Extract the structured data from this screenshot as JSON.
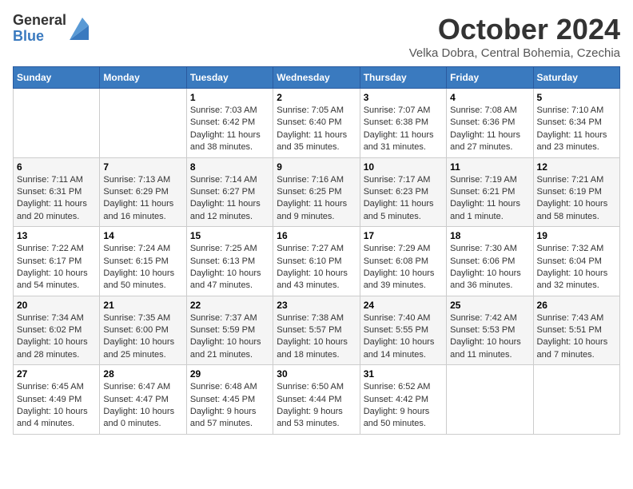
{
  "logo": {
    "general": "General",
    "blue": "Blue"
  },
  "title": "October 2024",
  "subtitle": "Velka Dobra, Central Bohemia, Czechia",
  "days_header": [
    "Sunday",
    "Monday",
    "Tuesday",
    "Wednesday",
    "Thursday",
    "Friday",
    "Saturday"
  ],
  "weeks": [
    [
      {
        "day": "",
        "sunrise": "",
        "sunset": "",
        "daylight": ""
      },
      {
        "day": "",
        "sunrise": "",
        "sunset": "",
        "daylight": ""
      },
      {
        "day": "1",
        "sunrise": "Sunrise: 7:03 AM",
        "sunset": "Sunset: 6:42 PM",
        "daylight": "Daylight: 11 hours and 38 minutes."
      },
      {
        "day": "2",
        "sunrise": "Sunrise: 7:05 AM",
        "sunset": "Sunset: 6:40 PM",
        "daylight": "Daylight: 11 hours and 35 minutes."
      },
      {
        "day": "3",
        "sunrise": "Sunrise: 7:07 AM",
        "sunset": "Sunset: 6:38 PM",
        "daylight": "Daylight: 11 hours and 31 minutes."
      },
      {
        "day": "4",
        "sunrise": "Sunrise: 7:08 AM",
        "sunset": "Sunset: 6:36 PM",
        "daylight": "Daylight: 11 hours and 27 minutes."
      },
      {
        "day": "5",
        "sunrise": "Sunrise: 7:10 AM",
        "sunset": "Sunset: 6:34 PM",
        "daylight": "Daylight: 11 hours and 23 minutes."
      }
    ],
    [
      {
        "day": "6",
        "sunrise": "Sunrise: 7:11 AM",
        "sunset": "Sunset: 6:31 PM",
        "daylight": "Daylight: 11 hours and 20 minutes."
      },
      {
        "day": "7",
        "sunrise": "Sunrise: 7:13 AM",
        "sunset": "Sunset: 6:29 PM",
        "daylight": "Daylight: 11 hours and 16 minutes."
      },
      {
        "day": "8",
        "sunrise": "Sunrise: 7:14 AM",
        "sunset": "Sunset: 6:27 PM",
        "daylight": "Daylight: 11 hours and 12 minutes."
      },
      {
        "day": "9",
        "sunrise": "Sunrise: 7:16 AM",
        "sunset": "Sunset: 6:25 PM",
        "daylight": "Daylight: 11 hours and 9 minutes."
      },
      {
        "day": "10",
        "sunrise": "Sunrise: 7:17 AM",
        "sunset": "Sunset: 6:23 PM",
        "daylight": "Daylight: 11 hours and 5 minutes."
      },
      {
        "day": "11",
        "sunrise": "Sunrise: 7:19 AM",
        "sunset": "Sunset: 6:21 PM",
        "daylight": "Daylight: 11 hours and 1 minute."
      },
      {
        "day": "12",
        "sunrise": "Sunrise: 7:21 AM",
        "sunset": "Sunset: 6:19 PM",
        "daylight": "Daylight: 10 hours and 58 minutes."
      }
    ],
    [
      {
        "day": "13",
        "sunrise": "Sunrise: 7:22 AM",
        "sunset": "Sunset: 6:17 PM",
        "daylight": "Daylight: 10 hours and 54 minutes."
      },
      {
        "day": "14",
        "sunrise": "Sunrise: 7:24 AM",
        "sunset": "Sunset: 6:15 PM",
        "daylight": "Daylight: 10 hours and 50 minutes."
      },
      {
        "day": "15",
        "sunrise": "Sunrise: 7:25 AM",
        "sunset": "Sunset: 6:13 PM",
        "daylight": "Daylight: 10 hours and 47 minutes."
      },
      {
        "day": "16",
        "sunrise": "Sunrise: 7:27 AM",
        "sunset": "Sunset: 6:10 PM",
        "daylight": "Daylight: 10 hours and 43 minutes."
      },
      {
        "day": "17",
        "sunrise": "Sunrise: 7:29 AM",
        "sunset": "Sunset: 6:08 PM",
        "daylight": "Daylight: 10 hours and 39 minutes."
      },
      {
        "day": "18",
        "sunrise": "Sunrise: 7:30 AM",
        "sunset": "Sunset: 6:06 PM",
        "daylight": "Daylight: 10 hours and 36 minutes."
      },
      {
        "day": "19",
        "sunrise": "Sunrise: 7:32 AM",
        "sunset": "Sunset: 6:04 PM",
        "daylight": "Daylight: 10 hours and 32 minutes."
      }
    ],
    [
      {
        "day": "20",
        "sunrise": "Sunrise: 7:34 AM",
        "sunset": "Sunset: 6:02 PM",
        "daylight": "Daylight: 10 hours and 28 minutes."
      },
      {
        "day": "21",
        "sunrise": "Sunrise: 7:35 AM",
        "sunset": "Sunset: 6:00 PM",
        "daylight": "Daylight: 10 hours and 25 minutes."
      },
      {
        "day": "22",
        "sunrise": "Sunrise: 7:37 AM",
        "sunset": "Sunset: 5:59 PM",
        "daylight": "Daylight: 10 hours and 21 minutes."
      },
      {
        "day": "23",
        "sunrise": "Sunrise: 7:38 AM",
        "sunset": "Sunset: 5:57 PM",
        "daylight": "Daylight: 10 hours and 18 minutes."
      },
      {
        "day": "24",
        "sunrise": "Sunrise: 7:40 AM",
        "sunset": "Sunset: 5:55 PM",
        "daylight": "Daylight: 10 hours and 14 minutes."
      },
      {
        "day": "25",
        "sunrise": "Sunrise: 7:42 AM",
        "sunset": "Sunset: 5:53 PM",
        "daylight": "Daylight: 10 hours and 11 minutes."
      },
      {
        "day": "26",
        "sunrise": "Sunrise: 7:43 AM",
        "sunset": "Sunset: 5:51 PM",
        "daylight": "Daylight: 10 hours and 7 minutes."
      }
    ],
    [
      {
        "day": "27",
        "sunrise": "Sunrise: 6:45 AM",
        "sunset": "Sunset: 4:49 PM",
        "daylight": "Daylight: 10 hours and 4 minutes."
      },
      {
        "day": "28",
        "sunrise": "Sunrise: 6:47 AM",
        "sunset": "Sunset: 4:47 PM",
        "daylight": "Daylight: 10 hours and 0 minutes."
      },
      {
        "day": "29",
        "sunrise": "Sunrise: 6:48 AM",
        "sunset": "Sunset: 4:45 PM",
        "daylight": "Daylight: 9 hours and 57 minutes."
      },
      {
        "day": "30",
        "sunrise": "Sunrise: 6:50 AM",
        "sunset": "Sunset: 4:44 PM",
        "daylight": "Daylight: 9 hours and 53 minutes."
      },
      {
        "day": "31",
        "sunrise": "Sunrise: 6:52 AM",
        "sunset": "Sunset: 4:42 PM",
        "daylight": "Daylight: 9 hours and 50 minutes."
      },
      {
        "day": "",
        "sunrise": "",
        "sunset": "",
        "daylight": ""
      },
      {
        "day": "",
        "sunrise": "",
        "sunset": "",
        "daylight": ""
      }
    ]
  ]
}
